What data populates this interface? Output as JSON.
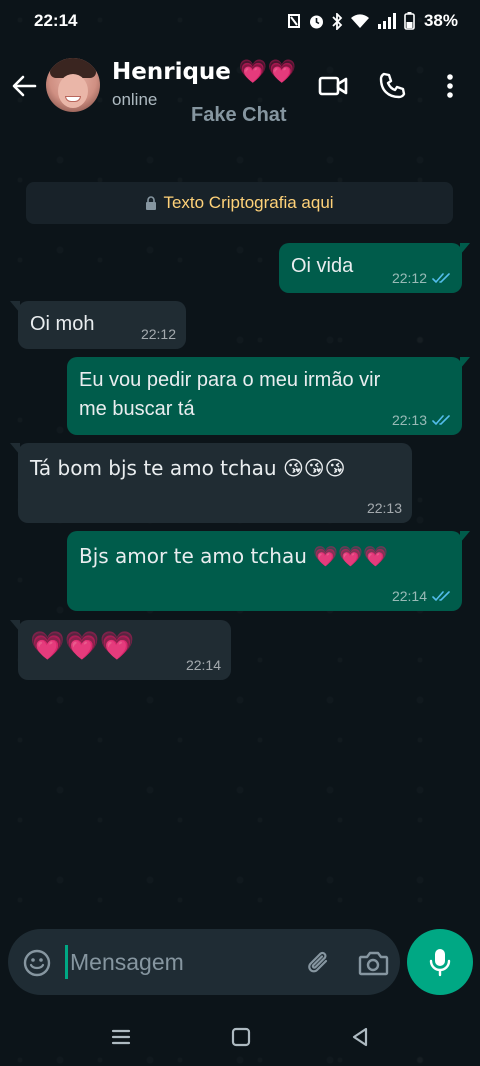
{
  "status_bar": {
    "time": "22:14",
    "battery": "38%"
  },
  "header": {
    "contact_name": "Henrique 💗💗",
    "status": "online",
    "app_label": "Fake Chat"
  },
  "encryption_notice": {
    "text": "Texto Criptografia aqui",
    "color": "#ffd279"
  },
  "messages": [
    {
      "direction": "out",
      "text": "Oi vida",
      "time": "22:12",
      "read": true
    },
    {
      "direction": "in",
      "text": "Oi moh",
      "time": "22:12"
    },
    {
      "direction": "out",
      "text_line1": "Eu vou pedir para o meu irmão vir",
      "text_line2": "me buscar tá",
      "time": "22:13",
      "read": true
    },
    {
      "direction": "in",
      "text": "Tá bom bjs te amo tchau 😘😘😘",
      "time": "22:13"
    },
    {
      "direction": "out",
      "text": "Bjs amor te amo tchau 💗💗💗",
      "time": "22:14",
      "read": true
    },
    {
      "direction": "in",
      "text": "💗💗💗",
      "time": "22:14"
    }
  ],
  "input": {
    "placeholder": "Mensagem"
  },
  "icons": {
    "back": "back-arrow-icon",
    "video": "video-call-icon",
    "call": "phone-icon",
    "menu": "more-vert-icon",
    "lock": "lock-icon",
    "emoji": "emoji-icon",
    "attach": "paperclip-icon",
    "camera": "camera-icon",
    "mic": "mic-icon"
  },
  "colors": {
    "background": "#0b141a",
    "outgoing_bubble": "#005c4b",
    "incoming_bubble": "#202c33",
    "accent": "#00a884",
    "read_tick": "#53bdeb"
  }
}
